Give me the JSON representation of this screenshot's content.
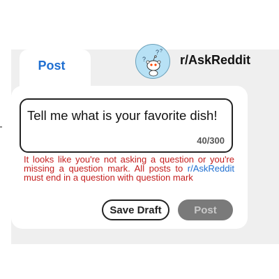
{
  "tabs": {
    "post_label": "Post"
  },
  "subreddit": {
    "name": "r/AskReddit",
    "icon": "askreddit-snoo-icon"
  },
  "composer": {
    "title_text": "Tell me what is your favorite dish!",
    "char_counter": "40/300"
  },
  "warning": {
    "text_before": "It looks like you're not asking a question or you're missing a question mark. All posts to ",
    "link_text": "r/AskReddit",
    "text_after": " must end in a question with question mark"
  },
  "actions": {
    "save_draft_label": "Save Draft",
    "post_label": "Post"
  },
  "colors": {
    "accent_blue": "#1f6fd1",
    "warning_red": "#c41e1e",
    "panel_bg": "#efefef",
    "disabled_button": "#7a7a7a"
  }
}
